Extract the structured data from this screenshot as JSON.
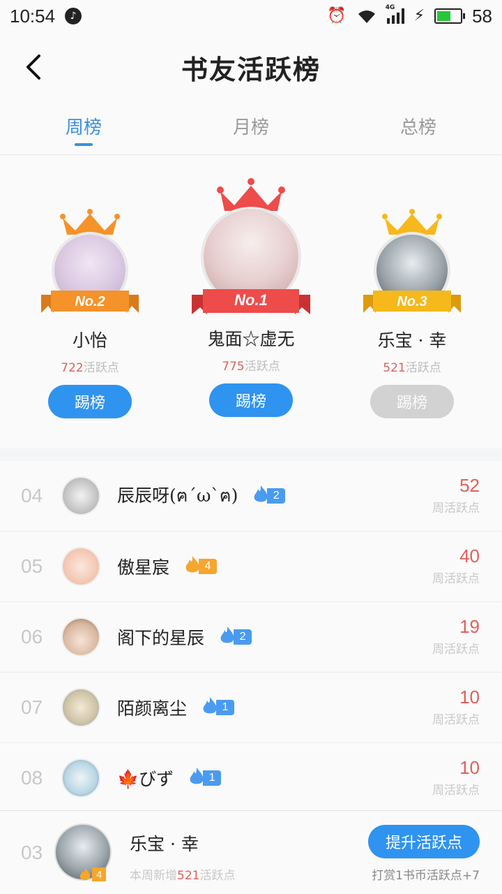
{
  "status_bar": {
    "time": "10:54",
    "network": "4G",
    "battery_pct": "58",
    "battery_level": 0.58
  },
  "header": {
    "title": "书友活跃榜"
  },
  "tabs": [
    {
      "label": "周榜",
      "active": true
    },
    {
      "label": "月榜",
      "active": false
    },
    {
      "label": "总榜",
      "active": false
    }
  ],
  "podium": [
    {
      "rank_label": "No.2",
      "name": "小怡",
      "score": "722",
      "score_unit": "活跃点",
      "button": "踢榜",
      "color": "#f5922a"
    },
    {
      "rank_label": "No.1",
      "name": "鬼面☆虚无",
      "score": "775",
      "score_unit": "活跃点",
      "button": "踢榜",
      "color": "#ee4b4b"
    },
    {
      "rank_label": "No.3",
      "name": "乐宝 · 幸",
      "score": "521",
      "score_unit": "活跃点",
      "button": "踢榜",
      "color": "#f6b81a"
    }
  ],
  "list": [
    {
      "rank": "04",
      "name": "辰辰呀(ฅ´ω`ฅ)",
      "level": "2",
      "badge_color": "blue",
      "score": "52",
      "unit": "周活跃点"
    },
    {
      "rank": "05",
      "name": "傲星宸",
      "level": "4",
      "badge_color": "orange",
      "score": "40",
      "unit": "周活跃点"
    },
    {
      "rank": "06",
      "name": "阁下的星辰",
      "level": "2",
      "badge_color": "blue",
      "score": "19",
      "unit": "周活跃点"
    },
    {
      "rank": "07",
      "name": "陌颜离尘",
      "level": "1",
      "badge_color": "blue",
      "score": "10",
      "unit": "周活跃点"
    },
    {
      "rank": "08",
      "name": "🍁びず",
      "level": "1",
      "badge_color": "blue",
      "score": "10",
      "unit": "周活跃点"
    }
  ],
  "me": {
    "rank": "03",
    "name": "乐宝 · 幸",
    "level": "4",
    "weekly_prefix": "本周新增",
    "weekly_value": "521",
    "weekly_suffix": "活跃点",
    "boost_button": "提升活跃点",
    "reward_note": "打赏1书币活跃点+7"
  },
  "colors": {
    "accent": "#2f93f0",
    "score": "#e0605a",
    "disabled": "#d2d2d2"
  }
}
